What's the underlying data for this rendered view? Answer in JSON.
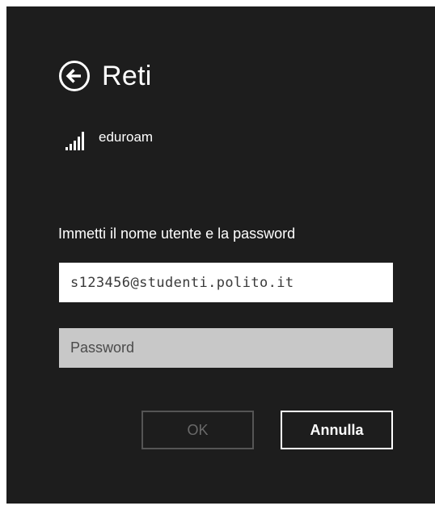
{
  "header": {
    "title": "Reti",
    "back_icon": "back-arrow-icon"
  },
  "network": {
    "name": "eduroam",
    "signal_icon": "wifi-signal-icon",
    "signal_bars_filled": 5
  },
  "form": {
    "prompt": "Immetti il nome utente e la password",
    "username_value": "s123456@studenti.polito.it",
    "password_placeholder": "Password",
    "password_value": ""
  },
  "buttons": {
    "ok_label": "OK",
    "cancel_label": "Annulla",
    "ok_enabled": false
  },
  "colors": {
    "panel_background": "#1d1d1d",
    "text": "#ffffff",
    "password_field_background": "#c8c8c8",
    "disabled_button": "#555555"
  }
}
